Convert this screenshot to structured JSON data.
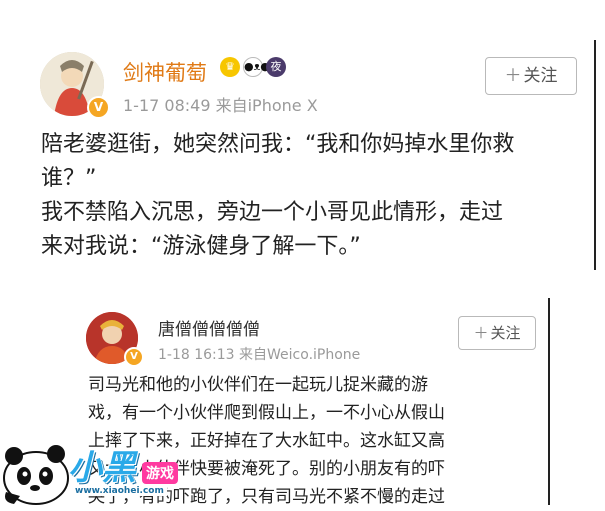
{
  "post1": {
    "username": "剑神葡萄",
    "verified_badge": "V",
    "badges": [
      "crown-icon",
      "panda-icon",
      "夜"
    ],
    "timestamp": "1-17 08:49",
    "source": "来自iPhone X",
    "follow_label": "关注",
    "lines": [
      "陪老婆逛街，她突然问我：“我和你妈掉水里你救",
      "谁？”",
      "我不禁陷入沉思，旁边一个小哥见此情形，走过",
      "来对我说：“游泳健身了解一下。”"
    ]
  },
  "post2": {
    "username": "唐僧僧僧僧僧",
    "verified_badge": "V",
    "timestamp": "1-18 16:13",
    "source": "来自Weico.iPhone",
    "follow_label": "关注",
    "lines": [
      "司马光和他的小伙伴们在一起玩儿捉米藏的游",
      "戏，有一个小伙伴爬到假山上，一不小心从假山",
      "上摔了下来，正好掉在了大水缸中。这水缸又高",
      "又大，小伙伴快要被淹死了。别的小朋友有的吓",
      "哭了，有的吓跑了，只有司马光不紧不慢的走过"
    ]
  },
  "watermark": {
    "brand": "小黑",
    "tag": "游戏",
    "url": "www.xiaohei.com"
  },
  "colors": {
    "username1": "#e07a16",
    "logo_blue": "#2aa9e8",
    "logo_pink": "#ff3aa0"
  }
}
